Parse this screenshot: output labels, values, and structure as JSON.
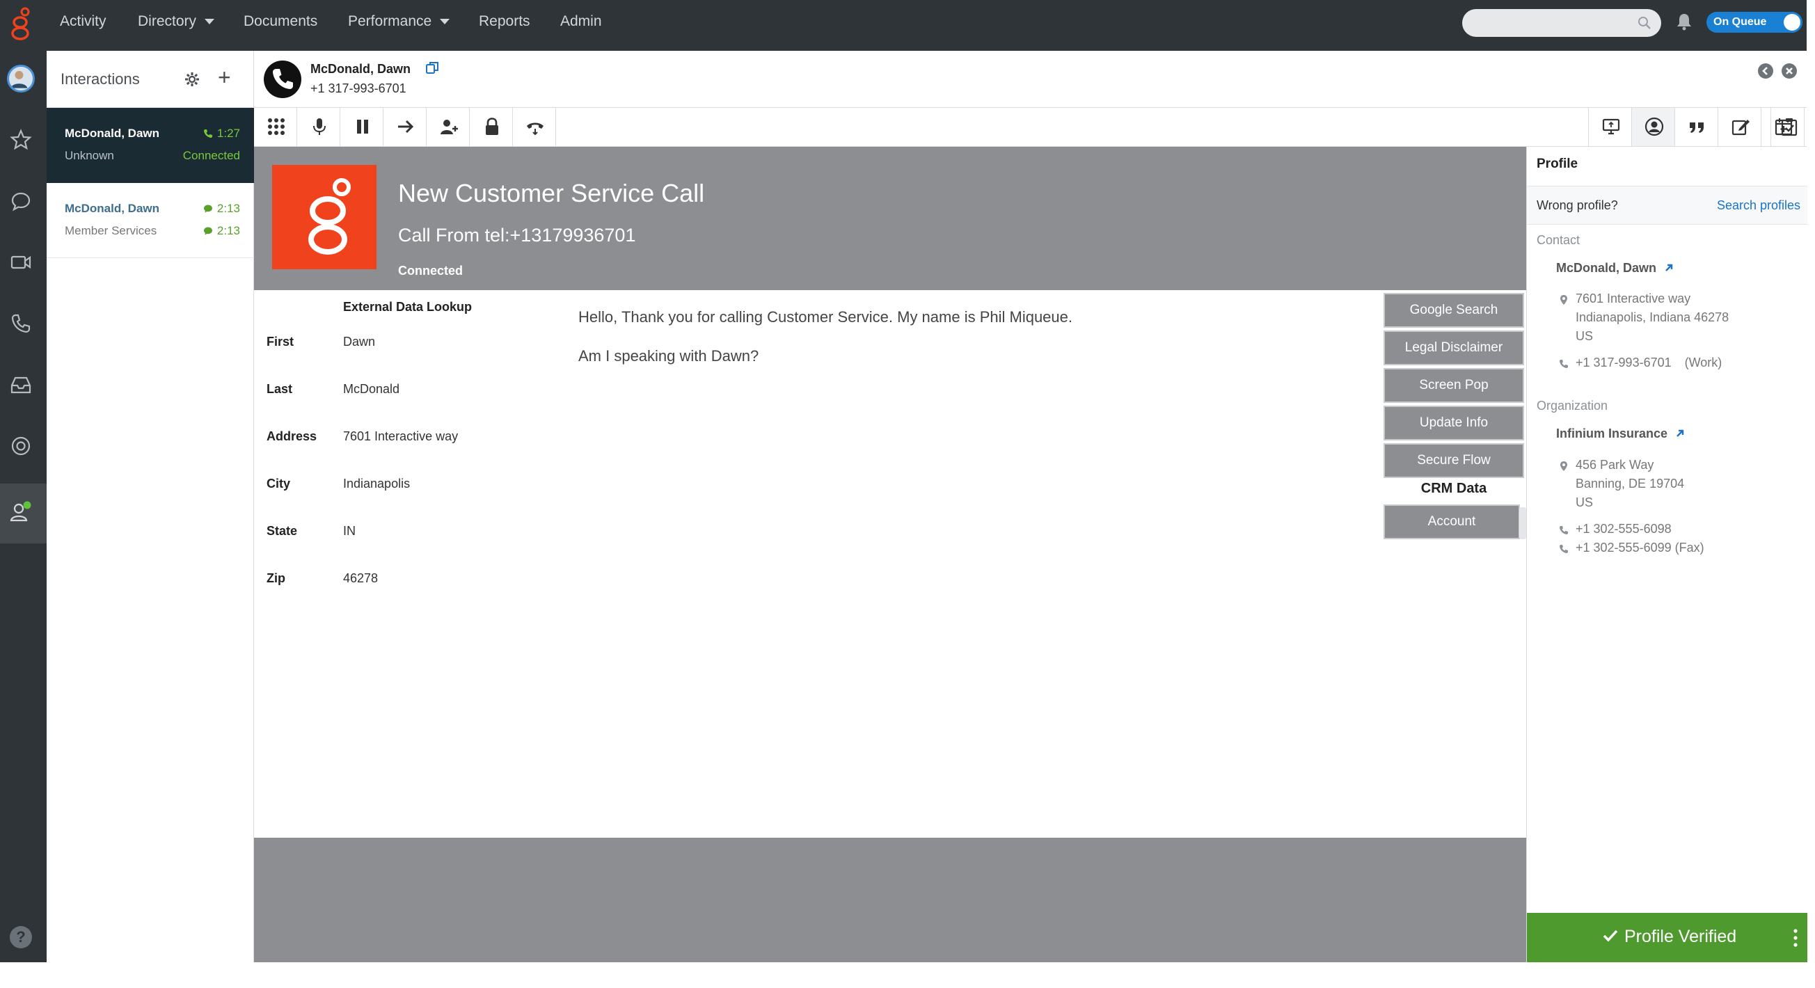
{
  "nav": {
    "items": [
      {
        "label": "Activity"
      },
      {
        "label": "Directory",
        "has_caret": true
      },
      {
        "label": "Documents"
      },
      {
        "label": "Performance",
        "has_caret": true
      },
      {
        "label": "Reports"
      },
      {
        "label": "Admin"
      }
    ],
    "search_placeholder": "",
    "queue_toggle_label": "On Queue",
    "queue_on": true
  },
  "interactions": {
    "title": "Interactions",
    "items": [
      {
        "name": "McDonald, Dawn",
        "sub": "Unknown",
        "time1": "1:27",
        "time2": "Connected",
        "type": "phone",
        "active": true
      },
      {
        "name": "McDonald, Dawn",
        "sub": "Member Services",
        "time1": "2:13",
        "time2": "2:13",
        "type": "chat",
        "active": false
      }
    ]
  },
  "call": {
    "name": "McDonald, Dawn",
    "phone": "+1 317-993-6701"
  },
  "script": {
    "banner_title": "New Customer Service Call",
    "banner_from": "Call From tel:+13179936701",
    "banner_status": "Connected",
    "external_title": "External Data Lookup",
    "fields": [
      {
        "label": "First",
        "value": "Dawn"
      },
      {
        "label": "Last",
        "value": "McDonald"
      },
      {
        "label": "Address",
        "value": "7601 Interactive way"
      },
      {
        "label": "City",
        "value": "Indianapolis"
      },
      {
        "label": "State",
        "value": "IN"
      },
      {
        "label": "Zip",
        "value": "46278"
      }
    ],
    "lines": [
      "Hello, Thank you for calling Customer Service. My name is Phil Miqueue.",
      "Am I speaking with Dawn?"
    ],
    "buttons": [
      "Google Search",
      "Legal Disclaimer",
      "Screen Pop",
      "Update Info",
      "Secure Flow"
    ],
    "crm_label": "CRM Data",
    "crm_button": "Account"
  },
  "profile": {
    "title": "Profile",
    "wrong_profile": "Wrong profile?",
    "search_profiles": "Search profiles",
    "contact_label": "Contact",
    "contact_name": "McDonald, Dawn",
    "contact_address": [
      "7601 Interactive way",
      "Indianapolis, Indiana 46278",
      "US"
    ],
    "contact_phone": "+1 317-993-6701",
    "contact_phone_type": "(Work)",
    "org_label": "Organization",
    "org_name": "Infinium Insurance",
    "org_address": [
      "456 Park Way",
      "Banning, DE 19704",
      "US"
    ],
    "org_phone": "+1 302-555-6098",
    "org_fax": "+1 302-555-6099 (Fax)",
    "verified_label": "Profile Verified"
  },
  "colors": {
    "nav_bg": "#2f3438",
    "brand_orange": "#f0431d",
    "accent_blue": "#1a80d4",
    "connected_green": "#78c83c",
    "verified_green": "#4f9a2e",
    "script_gray": "#8d8e92"
  }
}
